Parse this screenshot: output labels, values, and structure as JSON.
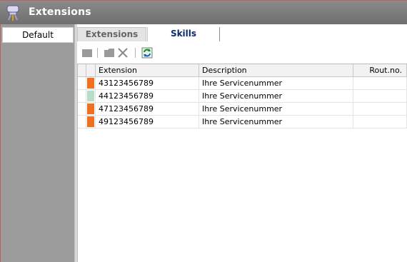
{
  "window": {
    "title": "Extensions",
    "app_icon": "plug-icon"
  },
  "left_panel": {
    "items": [
      {
        "label": "Default",
        "selected": true
      }
    ]
  },
  "tabs": [
    {
      "label": "Extensions",
      "active": false
    },
    {
      "label": "Skills",
      "active": true
    }
  ],
  "toolbar": {
    "buttons": [
      {
        "name": "new-icon",
        "enabled": false
      },
      {
        "name": "folder-icon",
        "enabled": false
      },
      {
        "name": "delete-icon",
        "enabled": false
      },
      {
        "name": "refresh-icon",
        "enabled": true
      }
    ]
  },
  "grid": {
    "columns": [
      "Extension",
      "Description",
      "Rout.no."
    ],
    "rows": [
      {
        "extension": "43123456789",
        "description": "Ihre Servicenummer",
        "rout_no": "",
        "indicator_color": "#f07020"
      },
      {
        "extension": "44123456789",
        "description": "Ihre Servicenummer",
        "rout_no": "",
        "indicator_color": "#b9dcc4"
      },
      {
        "extension": "47123456789",
        "description": "Ihre Servicenummer",
        "rout_no": "",
        "indicator_color": "#f07020"
      },
      {
        "extension": "49123456789",
        "description": "Ihre Servicenummer",
        "rout_no": "",
        "indicator_color": "#f07020"
      }
    ]
  },
  "colors": {
    "accent_text": "#0b2a6b",
    "titlebar": "#7b7b7b",
    "orange": "#f07020",
    "green": "#b9dcc4"
  }
}
